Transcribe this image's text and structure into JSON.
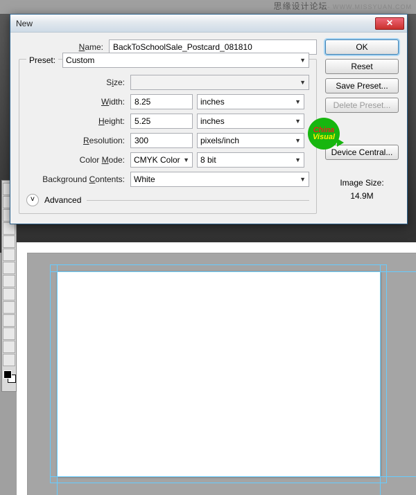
{
  "watermark": {
    "cn": "思缘设计论坛",
    "en": "- WWW.MISSYUAN.COM"
  },
  "dialog": {
    "title": "New",
    "name_label": "Name:",
    "name_value": "BackToSchoolSale_Postcard_081810",
    "preset_label": "Preset:",
    "preset_value": "Custom",
    "size_label": "Size:",
    "size_value": "",
    "width_label": "Width:",
    "width_value": "8.25",
    "width_unit": "inches",
    "height_label": "Height:",
    "height_value": "5.25",
    "height_unit": "inches",
    "resolution_label": "Resolution:",
    "resolution_value": "300",
    "resolution_unit": "pixels/inch",
    "colormode_label": "Color Mode:",
    "colormode_value": "CMYK Color",
    "colordepth_value": "8 bit",
    "bg_label": "Background Contents:",
    "bg_value": "White",
    "advanced_label": "Advanced",
    "imgsize_label": "Image Size:",
    "imgsize_value": "14.9M"
  },
  "buttons": {
    "ok": "OK",
    "reset": "Reset",
    "save_preset": "Save Preset...",
    "delete_preset": "Delete Preset...",
    "device_central": "Device Central..."
  },
  "badge": {
    "line1": "China",
    "line2": "Visual"
  }
}
